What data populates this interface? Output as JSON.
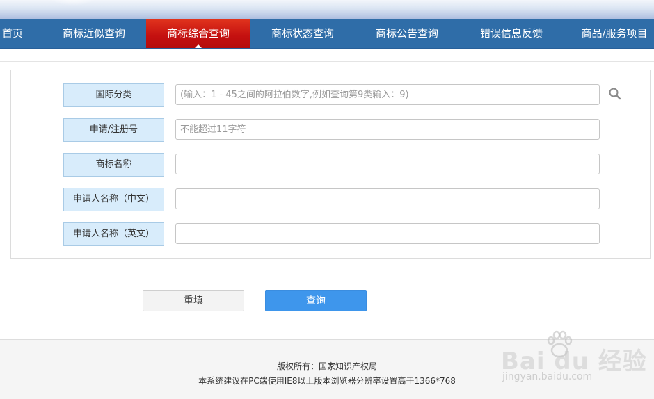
{
  "nav": {
    "items": [
      {
        "label": "首页",
        "active": false
      },
      {
        "label": "商标近似查询",
        "active": false
      },
      {
        "label": "商标综合查询",
        "active": true
      },
      {
        "label": "商标状态查询",
        "active": false
      },
      {
        "label": "商标公告查询",
        "active": false
      },
      {
        "label": "错误信息反馈",
        "active": false
      },
      {
        "label": "商品/服务项目",
        "active": false
      }
    ]
  },
  "form": {
    "fields": [
      {
        "label": "国际分类",
        "placeholder": "(输入：1 - 45之间的阿拉伯数字,例如查询第9类输入：9)",
        "value": ""
      },
      {
        "label": "申请/注册号",
        "placeholder": "不能超过11字符",
        "value": ""
      },
      {
        "label": "商标名称",
        "placeholder": "",
        "value": ""
      },
      {
        "label": "申请人名称（中文）",
        "placeholder": "",
        "value": ""
      },
      {
        "label": "申请人名称（英文）",
        "placeholder": "",
        "value": ""
      }
    ]
  },
  "buttons": {
    "reset_label": "重填",
    "query_label": "查询"
  },
  "footer": {
    "copyright": "版权所有：国家知识产权局",
    "notice": "本系统建议在PC端使用IE8以上版本浏览器分辨率设置高于1366*768"
  },
  "watermark": {
    "brand": "Bai du 经验",
    "url": "jingyan.baidu.com"
  },
  "colors": {
    "nav_bg": "#2f6da8",
    "nav_active": "#c41010",
    "label_bg": "#d8ecfb",
    "query_button": "#3e96ec"
  }
}
